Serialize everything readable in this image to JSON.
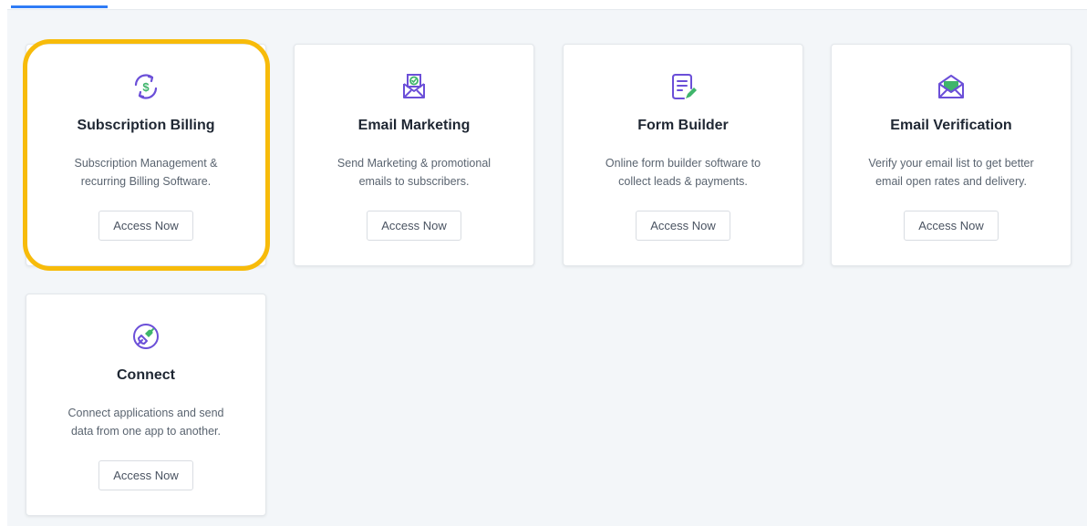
{
  "cards": [
    {
      "title": "Subscription Billing",
      "description_lines": [
        "Subscription Management &",
        "recurring Billing Software."
      ],
      "button_label": "Access Now",
      "icon": "subscription-billing-icon",
      "highlighted": true
    },
    {
      "title": "Email Marketing",
      "description_lines": [
        "Send Marketing & promotional",
        "emails to subscribers."
      ],
      "button_label": "Access Now",
      "icon": "email-marketing-icon"
    },
    {
      "title": "Form Builder",
      "description_lines": [
        "Online form builder software to",
        "collect leads & payments."
      ],
      "button_label": "Access Now",
      "icon": "form-builder-icon"
    },
    {
      "title": "Email Verification",
      "description_lines": [
        "Verify your email list to get better",
        "email open rates and delivery."
      ],
      "button_label": "Access Now",
      "icon": "email-verification-icon"
    },
    {
      "title": "Connect",
      "description_lines": [
        "Connect applications and send",
        "data from one app to another."
      ],
      "button_label": "Access Now",
      "icon": "connect-icon"
    }
  ],
  "colors": {
    "accent_tab": "#2f7cf6",
    "highlight": "#f7bb0a",
    "icon_purple": "#6b4fd8",
    "icon_green": "#3fb56b",
    "background": "#f3f6f9"
  }
}
